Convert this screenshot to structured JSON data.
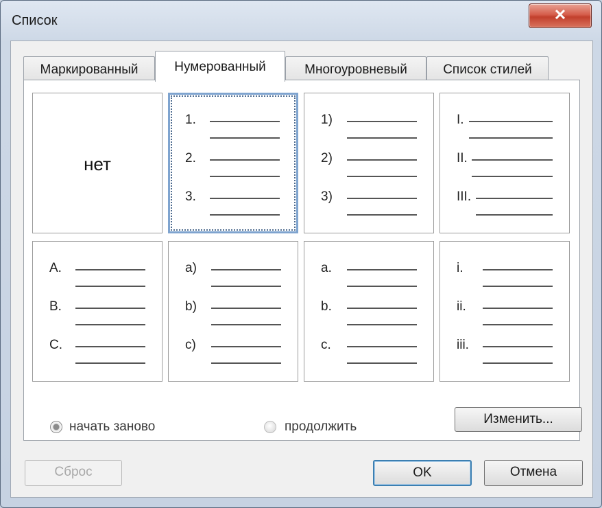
{
  "window": {
    "title": "Список",
    "close_symbol": "✕"
  },
  "tabs": [
    {
      "label": "Маркированный",
      "active": false
    },
    {
      "label": "Нумерованный",
      "active": true
    },
    {
      "label": "Многоуровневый",
      "active": false
    },
    {
      "label": "Список стилей",
      "active": false
    }
  ],
  "options": {
    "none_label": "нет",
    "arabic_dot": [
      "1.",
      "2.",
      "3."
    ],
    "arabic_paren": [
      "1)",
      "2)",
      "3)"
    ],
    "roman_upper": [
      "I.",
      "II.",
      "III."
    ],
    "alpha_upper": [
      "A.",
      "B.",
      "C."
    ],
    "alpha_lower_paren": [
      "a)",
      "b)",
      "c)"
    ],
    "alpha_lower_dot": [
      "a.",
      "b.",
      "c."
    ],
    "roman_lower": [
      "i.",
      "ii.",
      "iii."
    ]
  },
  "numbering": {
    "restart_label": "начать заново",
    "restart_selected": true,
    "continue_label": "продолжить",
    "continue_selected": false
  },
  "buttons": {
    "modify": "Изменить...",
    "reset": "Сброс",
    "ok": "OK",
    "cancel": "Отмена"
  }
}
